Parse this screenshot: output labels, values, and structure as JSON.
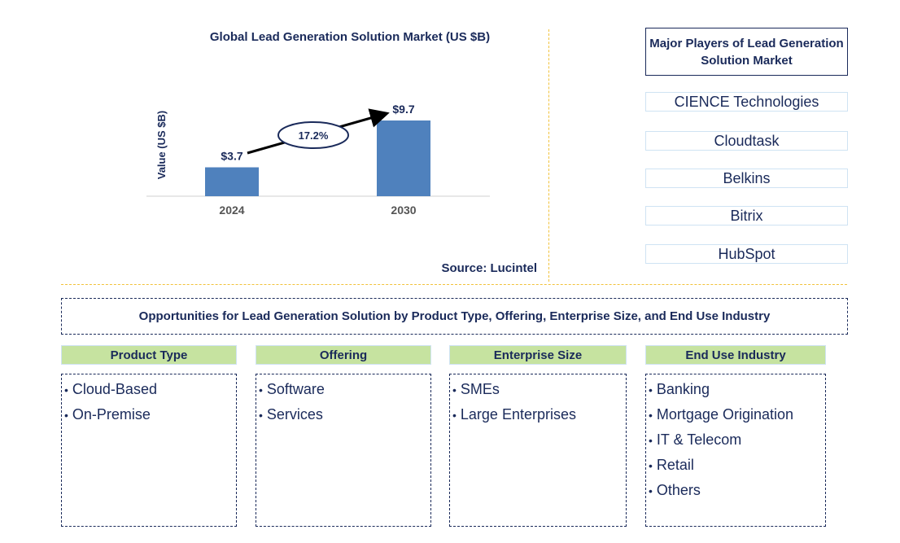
{
  "chart": {
    "title": "Global Lead Generation Solution Market (US $B)",
    "source": "Source: Lucintel"
  },
  "chart_data": {
    "type": "bar",
    "title": "Global Lead Generation Solution Market (US $B)",
    "categories": [
      "2024",
      "2030"
    ],
    "values": [
      3.7,
      9.7
    ],
    "data_labels": [
      "$3.7",
      "$9.7"
    ],
    "xlabel": "",
    "ylabel": "Value (US $B)",
    "ylim": [
      0,
      11
    ],
    "grid": false,
    "annotation": {
      "type": "cagr-arrow",
      "label": "17.2%"
    },
    "bar_color": "#4f81bd"
  },
  "players": {
    "heading": "Major Players of Lead Generation Solution Market",
    "items": [
      "CIENCE Technologies",
      "Cloudtask",
      "Belkins",
      "Bitrix",
      "HubSpot"
    ]
  },
  "opportunities": {
    "heading": "Opportunities for Lead Generation Solution by Product Type, Offering, Enterprise Size, and End Use Industry",
    "categories": [
      {
        "title": "Product Type",
        "items": [
          "Cloud-Based",
          "On-Premise"
        ]
      },
      {
        "title": "Offering",
        "items": [
          "Software",
          "Services"
        ]
      },
      {
        "title": "Enterprise Size",
        "items": [
          "SMEs",
          "Large Enterprises"
        ]
      },
      {
        "title": "End Use Industry",
        "items": [
          "Banking",
          "Mortgage Origination",
          "IT & Telecom",
          "Retail",
          "Others"
        ]
      }
    ]
  },
  "colors": {
    "navy": "#1a2a5a",
    "bar": "#4f81bd",
    "category_header": "#c6e3a0",
    "divider": "#f2c23a"
  }
}
